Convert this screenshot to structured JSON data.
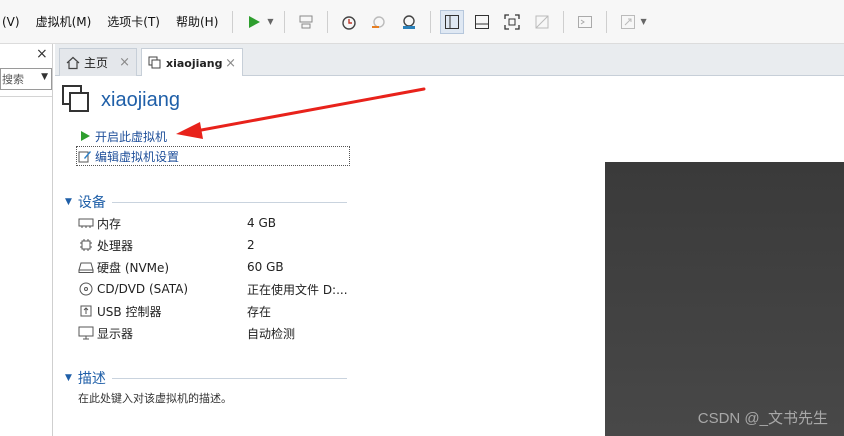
{
  "menubar": {
    "items": [
      "(V)",
      "虚拟机(M)",
      "选项卡(T)",
      "帮助(H)"
    ]
  },
  "toolbar": {
    "icons": [
      "play-icon",
      "send-keys-icon",
      "snapshot-icon",
      "revert-snapshot-icon",
      "snapshot-manager-icon",
      "library-view-icon",
      "console-view-icon",
      "fullscreen-icon",
      "unity-icon",
      "terminal-icon",
      "stretch-icon"
    ]
  },
  "library": {
    "close_label": "×",
    "search_label": "搜索",
    "search_arrow": "▼"
  },
  "tabs": [
    {
      "label": "主页",
      "icon": "home-icon",
      "close": "×"
    },
    {
      "label": "xiaojiang",
      "icon": "vm-icon",
      "close": "×"
    }
  ],
  "vm": {
    "title": "xiaojiang"
  },
  "actions": {
    "power_on": "开启此虚拟机",
    "edit_settings": "编辑虚拟机设置"
  },
  "devices_section": {
    "title": "设备",
    "caret": "▼",
    "rows": [
      {
        "name": "内存",
        "value": "4 GB",
        "icon": "memory-icon"
      },
      {
        "name": "处理器",
        "value": "2",
        "icon": "cpu-icon"
      },
      {
        "name": "硬盘 (NVMe)",
        "value": "60 GB",
        "icon": "disk-icon"
      },
      {
        "name": "CD/DVD (SATA)",
        "value": "正在使用文件 D:...",
        "icon": "cd-icon"
      },
      {
        "name": "USB 控制器",
        "value": "存在",
        "icon": "usb-icon"
      },
      {
        "name": "显示器",
        "value": "自动检测",
        "icon": "monitor-icon"
      }
    ]
  },
  "description_section": {
    "title": "描述",
    "caret": "▼",
    "text": "在此处键入对该虚拟机的描述。"
  },
  "watermark": "CSDN @_文书先生",
  "colors": {
    "accent": "#1f5fa8",
    "play_green": "#2e9e2e",
    "annotation_red": "#e8221b",
    "preview_bg": "#3f3f3f"
  }
}
